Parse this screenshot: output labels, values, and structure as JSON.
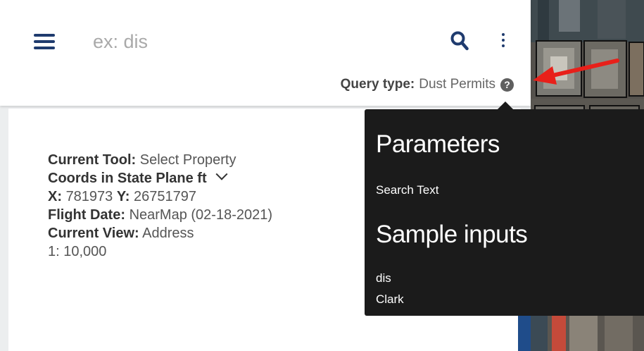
{
  "search": {
    "placeholder": "ex: dis",
    "query_type_label": "Query type:",
    "query_type_value": "Dust Permits",
    "help_glyph": "?"
  },
  "icons": {
    "menu": "hamburger-menu-icon",
    "search": "magnifier-search-icon",
    "more": "vertical-ellipsis-icon",
    "help": "question-circle-icon",
    "dropdown": "chevron-down-icon"
  },
  "info": {
    "current_tool_label": "Current Tool:",
    "current_tool_value": "Select Property",
    "coords_label": "Coords in",
    "coords_value": "State Plane ft",
    "x_label": "X:",
    "x_value": "781973",
    "y_label": "Y:",
    "y_value": "26751797",
    "flight_date_label": "Flight Date:",
    "flight_date_value": "NearMap (02-18-2021)",
    "current_view_label": "Current View:",
    "current_view_value": "Address",
    "scale": "1: 10,000"
  },
  "tooltip": {
    "heading_parameters": "Parameters",
    "parameter_1": "Search Text",
    "heading_samples": "Sample inputs",
    "sample_1": "dis",
    "sample_2": "Clark"
  },
  "colors": {
    "brand_navy": "#1f3b6e",
    "tooltip_bg": "#1b1b1b",
    "annotation_red": "#e8201a",
    "accent_blue": "#1f4c8a"
  }
}
